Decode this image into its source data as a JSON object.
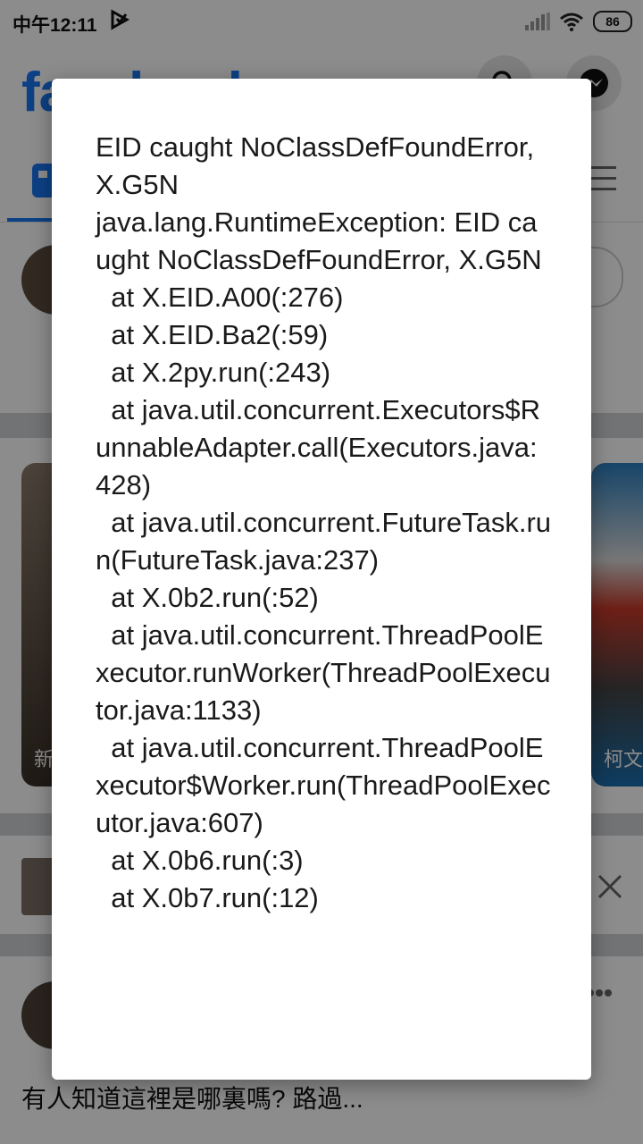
{
  "status_bar": {
    "time": "中午12:11",
    "battery": "86"
  },
  "facebook": {
    "logo_text": "facebook"
  },
  "stories": {
    "left_label": "新",
    "right_label": "柯文"
  },
  "post": {
    "text": "有人知道這裡是哪裏嗎? 路過..."
  },
  "dialog": {
    "message": "EID caught NoClassDefFoundError, X.G5N\njava.lang.RuntimeException: EID caught NoClassDefFoundError, X.G5N\n  at X.EID.A00(:276)\n  at X.EID.Ba2(:59)\n  at X.2py.run(:243)\n  at java.util.concurrent.Executors$RunnableAdapter.call(Executors.java:428)\n  at java.util.concurrent.FutureTask.run(FutureTask.java:237)\n  at X.0b2.run(:52)\n  at java.util.concurrent.ThreadPoolExecutor.runWorker(ThreadPoolExecutor.java:1133)\n  at java.util.concurrent.ThreadPoolExecutor$Worker.run(ThreadPoolExecutor.java:607)\n  at X.0b6.run(:3)\n  at X.0b7.run(:12)"
  },
  "colors": {
    "brand": "#1877f2"
  }
}
